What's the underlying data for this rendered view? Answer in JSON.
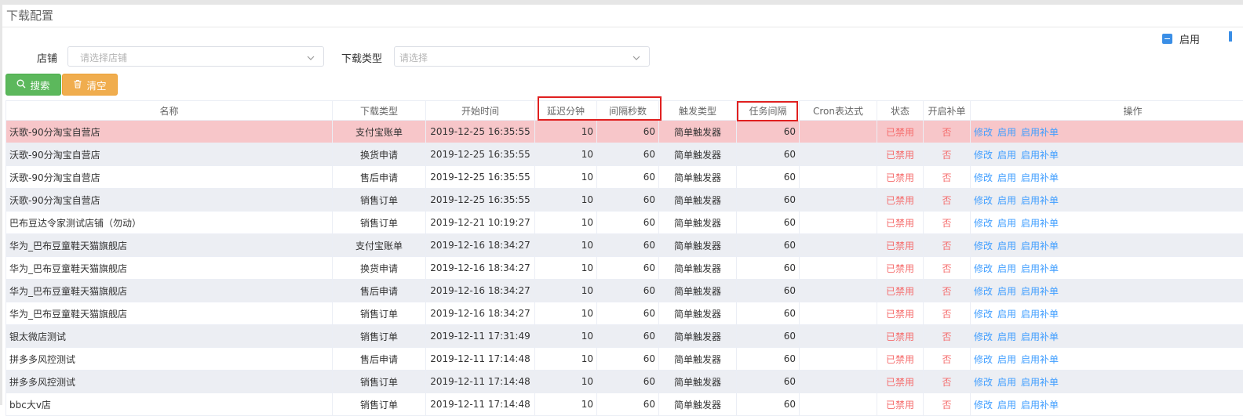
{
  "page": {
    "title": "下载配置"
  },
  "legend": {
    "label": "启用",
    "color": "#3a8ee6"
  },
  "filters": {
    "shop_label": "店铺",
    "shop_placeholder": "请选择店铺",
    "type_label": "下载类型",
    "type_placeholder": "请选择"
  },
  "buttons": {
    "search": "搜索",
    "clear": "清空"
  },
  "table": {
    "headers": [
      "名称",
      "下载类型",
      "开始时间",
      "延迟分钟",
      "间隔秒数",
      "触发类型",
      "任务间隔",
      "Cron表达式",
      "状态",
      "开启补单",
      "操作"
    ],
    "actions": [
      "修改",
      "启用",
      "启用补单"
    ],
    "rows": [
      {
        "name": "沃歌-90分淘宝自营店",
        "type": "支付宝账单",
        "start": "2019-12-25 16:35:55",
        "delay": "10",
        "interval": "60",
        "trigger": "简单触发器",
        "task_interval": "60",
        "cron": "",
        "status": "已禁用",
        "backfill": "否"
      },
      {
        "name": "沃歌-90分淘宝自营店",
        "type": "换货申请",
        "start": "2019-12-25 16:35:55",
        "delay": "10",
        "interval": "60",
        "trigger": "简单触发器",
        "task_interval": "60",
        "cron": "",
        "status": "已禁用",
        "backfill": "否"
      },
      {
        "name": "沃歌-90分淘宝自营店",
        "type": "售后申请",
        "start": "2019-12-25 16:35:55",
        "delay": "10",
        "interval": "60",
        "trigger": "简单触发器",
        "task_interval": "60",
        "cron": "",
        "status": "已禁用",
        "backfill": "否"
      },
      {
        "name": "沃歌-90分淘宝自营店",
        "type": "销售订单",
        "start": "2019-12-25 16:35:55",
        "delay": "10",
        "interval": "60",
        "trigger": "简单触发器",
        "task_interval": "60",
        "cron": "",
        "status": "已禁用",
        "backfill": "否"
      },
      {
        "name": "巴布豆达令家测试店铺（勿动）",
        "type": "销售订单",
        "start": "2019-12-21 10:19:27",
        "delay": "10",
        "interval": "60",
        "trigger": "简单触发器",
        "task_interval": "60",
        "cron": "",
        "status": "已禁用",
        "backfill": "否"
      },
      {
        "name": "华为_巴布豆童鞋天猫旗舰店",
        "type": "支付宝账单",
        "start": "2019-12-16 18:34:27",
        "delay": "10",
        "interval": "60",
        "trigger": "简单触发器",
        "task_interval": "60",
        "cron": "",
        "status": "已禁用",
        "backfill": "否"
      },
      {
        "name": "华为_巴布豆童鞋天猫旗舰店",
        "type": "换货申请",
        "start": "2019-12-16 18:34:27",
        "delay": "10",
        "interval": "60",
        "trigger": "简单触发器",
        "task_interval": "60",
        "cron": "",
        "status": "已禁用",
        "backfill": "否"
      },
      {
        "name": "华为_巴布豆童鞋天猫旗舰店",
        "type": "售后申请",
        "start": "2019-12-16 18:34:27",
        "delay": "10",
        "interval": "60",
        "trigger": "简单触发器",
        "task_interval": "60",
        "cron": "",
        "status": "已禁用",
        "backfill": "否"
      },
      {
        "name": "华为_巴布豆童鞋天猫旗舰店",
        "type": "销售订单",
        "start": "2019-12-16 18:34:27",
        "delay": "10",
        "interval": "60",
        "trigger": "简单触发器",
        "task_interval": "60",
        "cron": "",
        "status": "已禁用",
        "backfill": "否"
      },
      {
        "name": "银太微店测试",
        "type": "销售订单",
        "start": "2019-12-11 17:31:49",
        "delay": "10",
        "interval": "60",
        "trigger": "简单触发器",
        "task_interval": "60",
        "cron": "",
        "status": "已禁用",
        "backfill": "否"
      },
      {
        "name": "拼多多风控测试",
        "type": "售后申请",
        "start": "2019-12-11 17:14:48",
        "delay": "10",
        "interval": "60",
        "trigger": "简单触发器",
        "task_interval": "60",
        "cron": "",
        "status": "已禁用",
        "backfill": "否"
      },
      {
        "name": "拼多多风控测试",
        "type": "销售订单",
        "start": "2019-12-11 17:14:48",
        "delay": "10",
        "interval": "60",
        "trigger": "简单触发器",
        "task_interval": "60",
        "cron": "",
        "status": "已禁用",
        "backfill": "否"
      },
      {
        "name": "bbc大v店",
        "type": "销售订单",
        "start": "2019-12-11 17:14:48",
        "delay": "10",
        "interval": "60",
        "trigger": "简单触发器",
        "task_interval": "60",
        "cron": "",
        "status": "已禁用",
        "backfill": "否"
      }
    ]
  }
}
